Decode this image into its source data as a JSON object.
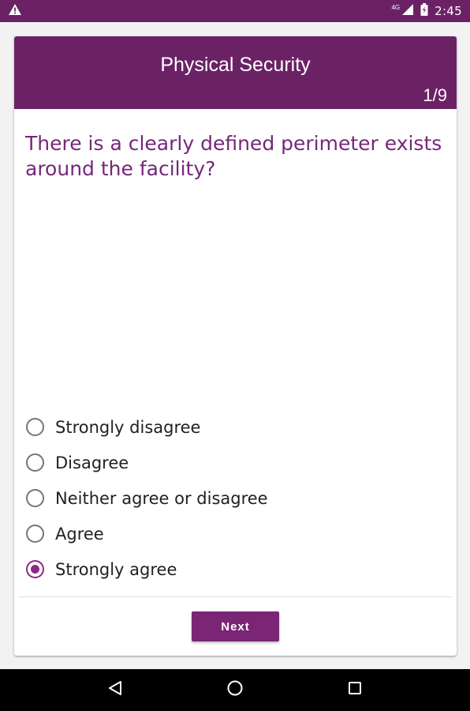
{
  "status_bar": {
    "network_type": "4G",
    "time": "2:45",
    "icons": [
      "warning-icon",
      "signal-icon",
      "battery-icon"
    ]
  },
  "header": {
    "title": "Physical Security",
    "page_counter": "1/9"
  },
  "question": {
    "text": "There is a clearly defined perimeter exists around the facility?"
  },
  "options": [
    {
      "label": "Strongly disagree",
      "selected": false
    },
    {
      "label": "Disagree",
      "selected": false
    },
    {
      "label": "Neither agree or disagree",
      "selected": false
    },
    {
      "label": "Agree",
      "selected": false
    },
    {
      "label": "Strongly agree",
      "selected": true
    }
  ],
  "actions": {
    "next_label": "Next"
  },
  "navigation": {
    "icons": [
      "back-icon",
      "home-icon",
      "recents-icon"
    ]
  },
  "colors": {
    "primary": "#6b2265",
    "accent": "#8b2a87",
    "question_text": "#76277a"
  }
}
